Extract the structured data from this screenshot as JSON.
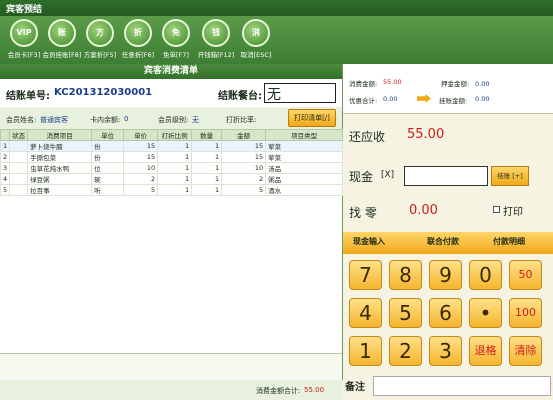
{
  "window": {
    "title": "宾客预结"
  },
  "toolbar": {
    "buttons": [
      {
        "label": "会员卡[F3]",
        "icon": "vip-card-icon",
        "glyph": "VIP"
      },
      {
        "label": "会员挂账[F8]",
        "icon": "member-account-icon",
        "glyph": "账"
      },
      {
        "label": "方案折[F5]",
        "icon": "scheme-discount-icon",
        "glyph": "方"
      },
      {
        "label": "任意折[F6]",
        "icon": "custom-discount-icon",
        "glyph": "折"
      },
      {
        "label": "免单[F7]",
        "icon": "free-order-icon",
        "glyph": "免"
      },
      {
        "label": "开钱箱[F12]",
        "icon": "cash-drawer-icon",
        "glyph": "钱"
      },
      {
        "label": "取消[ESC]",
        "icon": "cancel-icon",
        "glyph": "消"
      }
    ]
  },
  "list": {
    "title": "宾客消费清单",
    "bill_no_label": "结账单号:",
    "bill_no": "KC201312030001",
    "table_label": "结账餐台:",
    "table_value": "无",
    "member_name_label": "会员姓名:",
    "member_name": "普通宾客",
    "card_balance_label": "卡内余额:",
    "card_balance": "0",
    "member_level_label": "会员级别:",
    "member_level": "无",
    "discount_rate_label": "打折比率:",
    "print_button": "打印清单[/]",
    "columns": [
      "状态",
      "消费项目",
      "单位",
      "单价",
      "打折比例",
      "数量",
      "金额",
      "项目类型"
    ],
    "rows": [
      {
        "idx": "1",
        "status": "",
        "name": "萝卜烧牛腩",
        "unit": "份",
        "price": "15",
        "discount": "1",
        "qty": "1",
        "amount": "15",
        "type": "荤菜"
      },
      {
        "idx": "2",
        "status": "",
        "name": "手撕包菜",
        "unit": "份",
        "price": "15",
        "discount": "1",
        "qty": "1",
        "amount": "15",
        "type": "荤菜"
      },
      {
        "idx": "3",
        "status": "",
        "name": "虫草花炖水鸭",
        "unit": "位",
        "price": "10",
        "discount": "1",
        "qty": "1",
        "amount": "10",
        "type": "汤品"
      },
      {
        "idx": "4",
        "status": "",
        "name": "绿豆粥",
        "unit": "碗",
        "price": "2",
        "discount": "1",
        "qty": "1",
        "amount": "2",
        "type": "粥品"
      },
      {
        "idx": "5",
        "status": "",
        "name": "拉百事",
        "unit": "听",
        "price": "5",
        "discount": "1",
        "qty": "1",
        "amount": "5",
        "type": "酒水"
      }
    ],
    "total_label": "消费金额合计:",
    "total_value": "55.00"
  },
  "summary": {
    "consume_label": "消费金额:",
    "consume_value": "55.00",
    "deposit_label": "押金金额:",
    "deposit_value": "0.00",
    "discount_total_label": "优惠合计:",
    "discount_total_value": "0.00",
    "paid_label": "挂账金额:",
    "paid_value": "0.00"
  },
  "payment": {
    "due_label": "还应收",
    "due_value": "55.00",
    "cash_label": "现金",
    "cash_shortcut": "[X]",
    "confirm_button": "结账 [+]",
    "change_label": "找  零",
    "change_value": "0.00",
    "print_label": "打印"
  },
  "tabs": [
    "现金输入",
    "联合付款",
    "付款明细"
  ],
  "keypad": [
    {
      "label": "7",
      "small": false
    },
    {
      "label": "8",
      "small": false
    },
    {
      "label": "9",
      "small": false
    },
    {
      "label": "0",
      "small": false
    },
    {
      "label": "50",
      "small": true
    },
    {
      "label": "4",
      "small": false
    },
    {
      "label": "5",
      "small": false
    },
    {
      "label": "6",
      "small": false
    },
    {
      "label": "•",
      "small": false
    },
    {
      "label": "100",
      "small": true
    },
    {
      "label": "1",
      "small": false
    },
    {
      "label": "2",
      "small": false
    },
    {
      "label": "3",
      "small": false
    },
    {
      "label": "退格",
      "small": true
    },
    {
      "label": "清除",
      "small": true
    }
  ],
  "remark_label": "备注",
  "colors": {
    "accent": "#f0a818",
    "brand_green": "#3e7e34",
    "amount_red": "#d21a1a"
  }
}
